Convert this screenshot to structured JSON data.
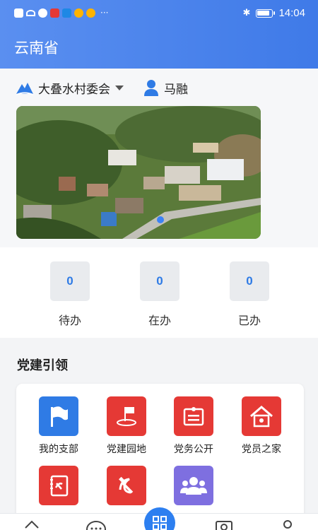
{
  "status": {
    "time": "14:04",
    "more": "···",
    "bluetooth_icon": "bluetooth-icon"
  },
  "header": {
    "title": "云南省"
  },
  "location": {
    "icon": "mountain-icon",
    "label": "大叠水村委会"
  },
  "user": {
    "icon": "person-icon",
    "name": "马融"
  },
  "banner": {
    "icon": "village-photo"
  },
  "counts": [
    {
      "value": "0",
      "label": "待办"
    },
    {
      "value": "0",
      "label": "在办"
    },
    {
      "value": "0",
      "label": "已办"
    }
  ],
  "section": {
    "title": "党建引领",
    "tiles": [
      {
        "label": "我的支部",
        "icon": "flag-icon",
        "color": "#2f7be5"
      },
      {
        "label": "党建园地",
        "icon": "party-garden-icon",
        "color": "#e53935"
      },
      {
        "label": "党务公开",
        "icon": "document-icon",
        "color": "#e53935"
      },
      {
        "label": "党员之家",
        "icon": "home-icon",
        "color": "#e53935"
      },
      {
        "label": "",
        "icon": "party-book-icon",
        "color": "#e53935"
      },
      {
        "label": "",
        "icon": "hammer-sickle-icon",
        "color": "#e53935"
      },
      {
        "label": "",
        "icon": "group-icon",
        "color": "#7e6fe0"
      }
    ]
  },
  "tabbar": {
    "accent": "#2d7ff0"
  }
}
